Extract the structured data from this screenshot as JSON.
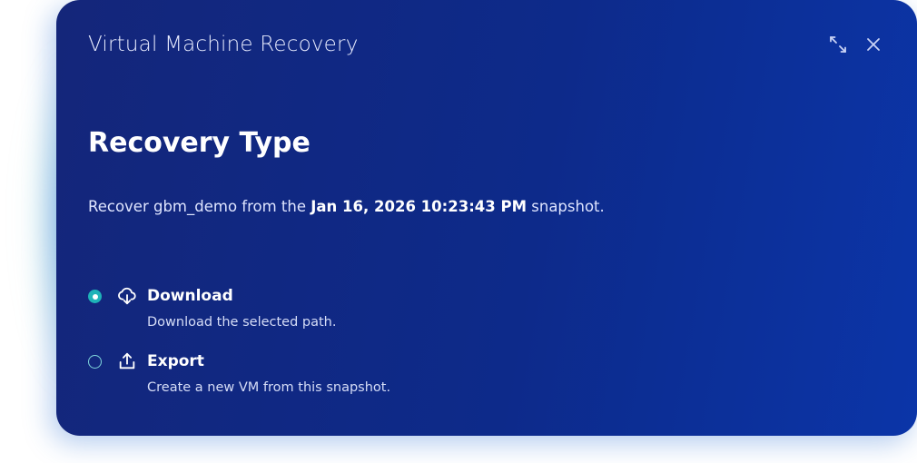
{
  "dialog": {
    "title": "Virtual Machine Recovery",
    "expand_icon": "expand-arrows-icon",
    "close_icon": "close-icon"
  },
  "section": {
    "title": "Recovery Type",
    "description_prefix": "Recover gbm_demo from the ",
    "description_timestamp": "Jan 16, 2026 10:23:43 PM",
    "description_suffix": " snapshot."
  },
  "options": [
    {
      "label": "Download",
      "description": "Download the selected path.",
      "icon": "cloud-download-icon",
      "selected": true
    },
    {
      "label": "Export",
      "description": "Create a new VM from this snapshot.",
      "icon": "upload-icon",
      "selected": false
    }
  ],
  "colors": {
    "dialog_bg": "#0d2a8a",
    "radio_accent": "#1fb3b8",
    "text": "#ffffff"
  }
}
